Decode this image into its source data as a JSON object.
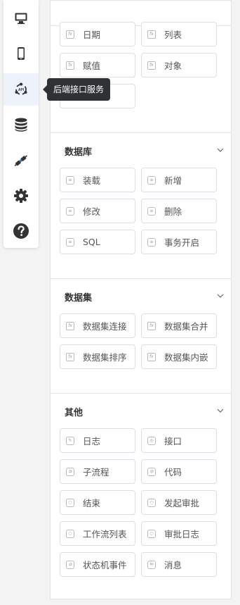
{
  "rail": {
    "items": [
      {
        "icon": "monitor-icon"
      },
      {
        "icon": "phone-icon"
      },
      {
        "icon": "api-icon"
      },
      {
        "icon": "database-icon"
      },
      {
        "icon": "plug-icon"
      },
      {
        "icon": "gear-icon"
      },
      {
        "icon": "help-icon"
      }
    ],
    "active_index": 2
  },
  "tooltip": {
    "text": "后端接口服务"
  },
  "panel": {
    "top_section": {
      "items": [
        "日期",
        "列表",
        "赋值",
        "对象"
      ]
    },
    "sections": [
      {
        "title": "数据库",
        "items": [
          "装载",
          "新增",
          "修改",
          "删除",
          "SQL",
          "事务开启"
        ]
      },
      {
        "title": "数据集",
        "items": [
          "数据集连接",
          "数据集合并",
          "数据集排序",
          "数据集内嵌"
        ]
      },
      {
        "title": "其他",
        "items": [
          "日志",
          "接口",
          "子流程",
          "代码",
          "结束",
          "发起审批",
          "工作流列表",
          "审批日志",
          "状态机事件",
          "消息"
        ]
      }
    ]
  },
  "colors": {
    "accent": "#1f6fd0",
    "icon_dark": "#333333",
    "active_bg": "#eef3fb"
  }
}
